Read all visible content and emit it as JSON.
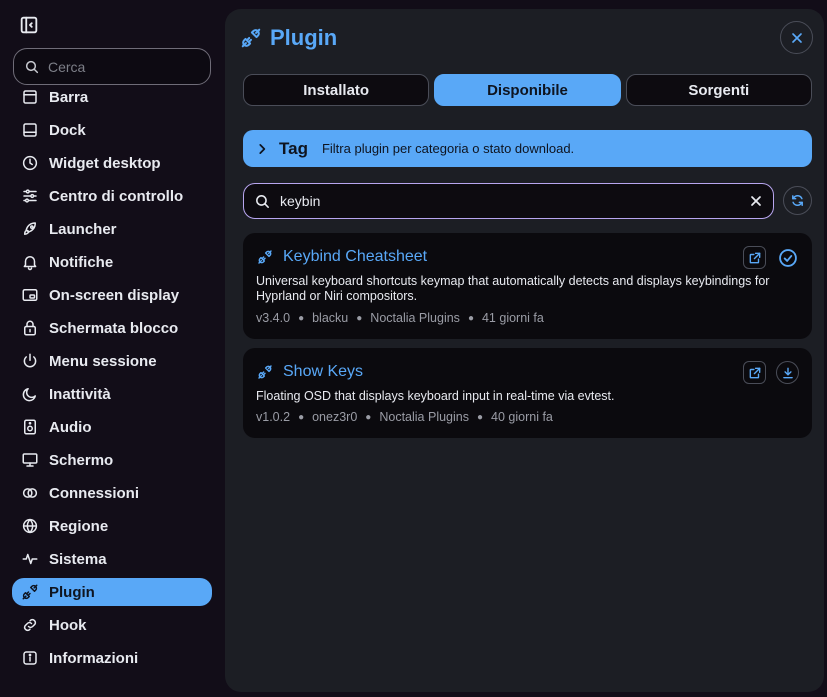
{
  "sidebar": {
    "search_placeholder": "Cerca",
    "items": [
      {
        "label": "Barra",
        "icon": "bar-icon"
      },
      {
        "label": "Dock",
        "icon": "dock-icon"
      },
      {
        "label": "Widget desktop",
        "icon": "clock-icon"
      },
      {
        "label": "Centro di controllo",
        "icon": "sliders-icon"
      },
      {
        "label": "Launcher",
        "icon": "rocket-icon"
      },
      {
        "label": "Notifiche",
        "icon": "bell-icon"
      },
      {
        "label": "On-screen display",
        "icon": "display-icon"
      },
      {
        "label": "Schermata blocco",
        "icon": "lock-icon"
      },
      {
        "label": "Menu sessione",
        "icon": "power-icon"
      },
      {
        "label": "Inattività",
        "icon": "moon-icon"
      },
      {
        "label": "Audio",
        "icon": "speaker-icon"
      },
      {
        "label": "Schermo",
        "icon": "monitor-icon"
      },
      {
        "label": "Connessioni",
        "icon": "link-icon"
      },
      {
        "label": "Regione",
        "icon": "globe-icon"
      },
      {
        "label": "Sistema",
        "icon": "pulse-icon"
      },
      {
        "label": "Plugin",
        "icon": "plug-icon",
        "active": true
      },
      {
        "label": "Hook",
        "icon": "chain-icon"
      },
      {
        "label": "Informazioni",
        "icon": "info-icon"
      }
    ]
  },
  "panel": {
    "title": "Plugin",
    "tabs": [
      {
        "label": "Installato"
      },
      {
        "label": "Disponibile",
        "active": true
      },
      {
        "label": "Sorgenti"
      }
    ],
    "tag": {
      "title": "Tag",
      "description": "Filtra plugin per categoria o stato download."
    },
    "search": {
      "value": "keybin"
    },
    "plugins": [
      {
        "name": "Keybind Cheatsheet",
        "description": "Universal keyboard shortcuts keymap that automatically detects and displays keybindings for Hyprland or Niri compositors.",
        "version": "v3.4.0",
        "author": "blacku",
        "source": "Noctalia Plugins",
        "age": "41 giorni fa",
        "status": "installed"
      },
      {
        "name": "Show Keys",
        "description": "Floating OSD that displays keyboard input in real-time via evtest.",
        "version": "v1.0.2",
        "author": "onez3r0",
        "source": "Noctalia Plugins",
        "age": "40 giorni fa",
        "status": "available"
      }
    ]
  },
  "colors": {
    "accent": "#59a8f7",
    "background": "#120d18",
    "panel": "#1c1e24",
    "card": "#0b0a0e",
    "search_border": "#b8a6f0"
  }
}
